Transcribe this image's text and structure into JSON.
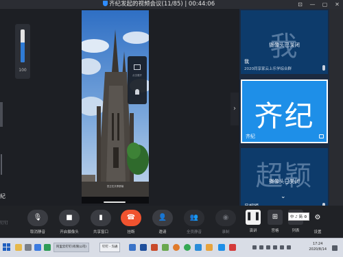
{
  "window": {
    "title": "齐纪发起的视频会议(11/85)",
    "separator": "|",
    "timer": "00:44:06"
  },
  "volume": {
    "value": "100",
    "level_fraction": 0.6
  },
  "left_label": "紀",
  "share": {
    "banner_text": "您正在共享屏幕",
    "panel_hint": "点击展开"
  },
  "participants": [
    {
      "avatar_char": "我",
      "camera_status": "摄像头已关闭",
      "name": "我",
      "sub": "2020同享家云上乐学综合群",
      "icon": "microphone-icon"
    },
    {
      "avatar_char": "齐纪",
      "name": "齐纪",
      "icon": "camera-icon"
    },
    {
      "avatar_char": "超颖",
      "camera_status": "摄像头已关闭",
      "name": "吴超颖",
      "icon": "microphone-icon"
    }
  ],
  "toolbar": {
    "left_label": "钉钉",
    "buttons": [
      {
        "label": "取消静音",
        "icon": "mic-off-icon"
      },
      {
        "label": "开启摄像头",
        "icon": "camera-icon"
      },
      {
        "label": "共享窗口",
        "icon": "share-icon"
      },
      {
        "label": "挂断",
        "icon": "hangup-icon"
      },
      {
        "label": "邀请",
        "icon": "invite-icon"
      },
      {
        "label": "全员静音",
        "icon": "mute-all-icon"
      },
      {
        "label": "录制",
        "icon": "record-icon"
      }
    ],
    "view_buttons": [
      {
        "label": "演讲",
        "icon": "speaker-view-icon"
      },
      {
        "label": "宫格",
        "icon": "grid-view-icon"
      },
      {
        "label": "列表",
        "icon": "list-view-icon"
      },
      {
        "label": "设置",
        "icon": "gear-icon"
      }
    ]
  },
  "ime": {
    "text": "中 ♪ 简 ⚙"
  },
  "taskbar": {
    "apps": [
      {
        "label": "阿里云钉钉(有限公司)"
      },
      {
        "label": "钉钉 - 沟通"
      }
    ],
    "clock": {
      "time": "17:24",
      "date": "2020/8/14"
    }
  },
  "colors": {
    "accent": "#1e8fe8",
    "hangup": "#f0532f",
    "tile": "#0d3b6b"
  }
}
